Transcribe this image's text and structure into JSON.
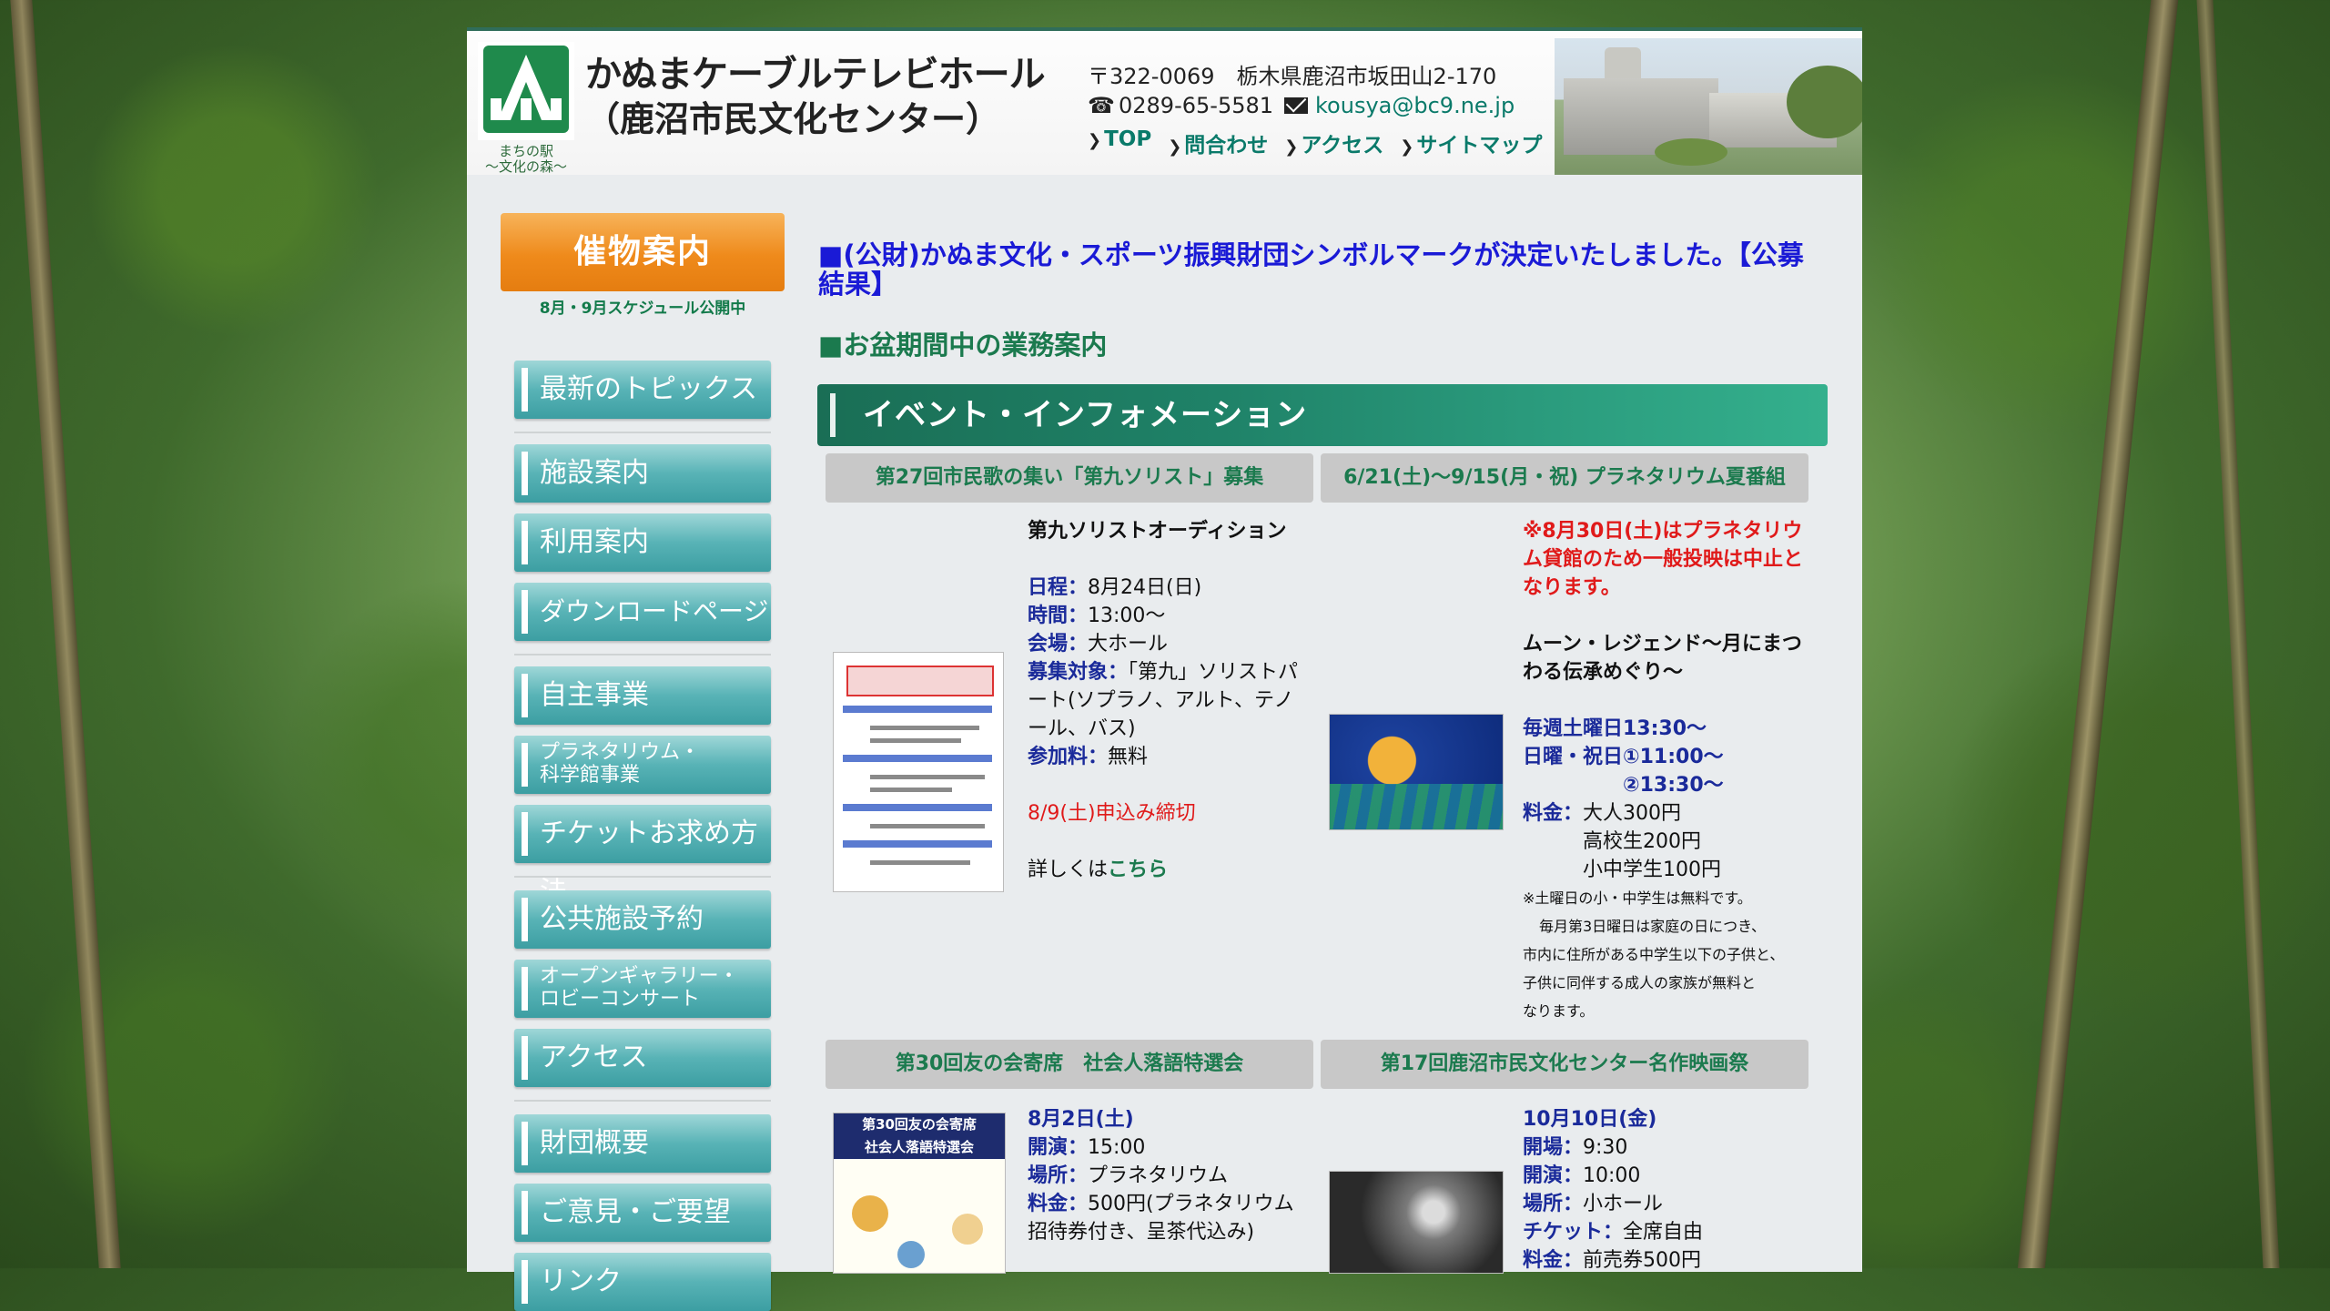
{
  "header": {
    "logo_caption": "まちの駅\n〜文化の森〜",
    "title": "かぬまケーブルテレビホール",
    "subtitle": "（鹿沼市民文化センター）",
    "address": "〒322-0069　栃木県鹿沼市坂田山2-170",
    "phone": "0289-65-5581",
    "email": "kousya@bc9.ne.jp",
    "nav": [
      "TOP",
      "問合わせ",
      "アクセス",
      "サイトマップ"
    ]
  },
  "sidebar": {
    "title": "催物案内",
    "note": "8月・9月スケジュール公開中",
    "items": [
      "最新のトピックス",
      "施設案内",
      "利用案内",
      "ダウンロードページ",
      "自主事業",
      "プラネタリウム・\n科学館事業",
      "チケットお求め方法",
      "公共施設予約",
      "オープンギャラリー・\nロビーコンサート",
      "アクセス",
      "財団概要",
      "ご意見・ご要望",
      "リンク"
    ]
  },
  "main": {
    "headline_mark": "■",
    "headline": "(公財)かぬま文化・スポーツ振興財団シンボルマークが決定いたしました。【公募結果】",
    "notice_mark": "■",
    "notice": "お盆期間中の業務案内",
    "section_title": "イベント・インフォメーション",
    "cards": [
      {
        "heading": "第27回市民歌の集い「第九ソリスト」募集",
        "title": "第九ソリストオーディション",
        "date_label": "日程：",
        "date": "8月24日(日)",
        "time_label": "時間：",
        "time": "13:00〜",
        "venue_label": "会場：",
        "venue": "大ホール",
        "target_label": "募集対象：",
        "target": "「第九」ソリストパート(ソプラノ、アルト、テノール、バス)",
        "fee_label": "参加料：",
        "fee": "無料",
        "deadline": "8/9(土)申込み締切",
        "more_prefix": "詳しくは",
        "more_link": "こちら"
      },
      {
        "heading": "6/21(土)〜9/15(月・祝) プラネタリウム夏番組",
        "alert": "※8月30日(土)はプラネタリウム貸館のため一般投映は中止となります。",
        "title": "ムーン・レジェンド〜月にまつわる伝承めぐり〜",
        "sched1": "毎週土曜日13:30〜",
        "sched2": "日曜・祝日①11:00〜",
        "sched3": "②13:30〜",
        "fee_label": "料金：",
        "fee1": "大人300円",
        "fee2": "高校生200円",
        "fee3": "小中学生100円",
        "note1": "※土曜日の小・中学生は無料です。",
        "note2": "毎月第3日曜日は家庭の日につき、",
        "note3": "市内に住所がある中学生以下の子供と、",
        "note4": "子供に同伴する成人の家族が無料と",
        "note5": "なります。"
      },
      {
        "heading": "第30回友の会寄席　社会人落語特選会",
        "poster_text": "第30回友の会寄席\n社会人落語特選会",
        "date": "8月2日(土)",
        "open_label": "開演：",
        "open": "15:00",
        "venue_label": "場所：",
        "venue": "プラネタリウム",
        "fee_label": "料金：",
        "fee": "500円(プラネタリウム招待券付き、呈茶代込み)"
      },
      {
        "heading": "第17回鹿沼市民文化センター名作映画祭",
        "date": "10月10日(金)",
        "doors_label": "開場：",
        "doors": "9:30",
        "open_label": "開演：",
        "open": "10:00",
        "venue_label": "場所：",
        "venue": "小ホール",
        "ticket_label": "チケット：",
        "ticket": "全席自由",
        "fee_label": "料金：",
        "fee": "前売券500円"
      }
    ]
  },
  "colors": {
    "accent_green": "#1b7a4e",
    "headline_blue": "#1a1ad6",
    "sidebar_teal": "#4aa9ad",
    "sidebar_orange": "#ef8a1b",
    "alert_red": "#e01a1a"
  }
}
